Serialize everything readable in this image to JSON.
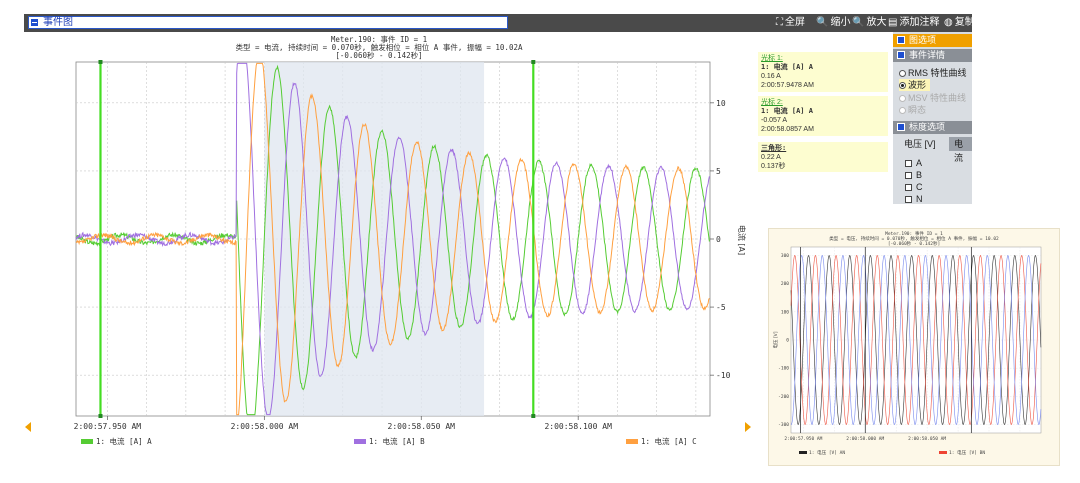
{
  "window": {
    "title": "事件图"
  },
  "toolbar": {
    "fullscreen_label": "全屏",
    "zoom_out_label": "缩小",
    "zoom_in_label": "放大",
    "add_note_label": "添加注释",
    "copy_label": "复制"
  },
  "chart": {
    "title_line1": "Meter.190: 事件 ID = 1",
    "title_line2": "类型 = 电流, 持续时间 = 0.070秒, 触发相位 = 相位 A 事件, 振幅 = 10.02A",
    "title_line3": "[-0.060秒 - 0.142秒]",
    "y_axis_title": "电流 [A]",
    "x_ticks": [
      "2:00:57.950 AM",
      "2:00:58.000 AM",
      "2:00:58.050 AM",
      "2:00:58.100 AM"
    ],
    "y_ticks": [
      "10",
      "5",
      "0",
      "-5",
      "-10"
    ],
    "legend": [
      {
        "label": "1: 电流 [A] A",
        "color": "#55cc33"
      },
      {
        "label": "1: 电流 [A] B",
        "color": "#a070e0"
      },
      {
        "label": "1: 电流 [A] C",
        "color": "#ffa040"
      }
    ]
  },
  "cursors": {
    "c1": {
      "header": "光标 1:",
      "channel": "1: 电流 [A] A",
      "value": "0.16 A",
      "time": "2:00:57.9478 AM"
    },
    "c2": {
      "header": "光标 2:",
      "channel": "1: 电流 [A] A",
      "value": "-0.057 A",
      "time": "2:00:58.0857 AM"
    },
    "delta": {
      "header": "三角形:",
      "value": "0.22 A",
      "time": "0.137秒"
    }
  },
  "options": {
    "header_chart": "图选项",
    "header_event": "事件详情",
    "radio_rms": "RMS 特性曲线",
    "radio_wave": "波形",
    "radio_msv": "MSV 特性曲线",
    "radio_transient": "瞬态",
    "header_scale": "标度选项",
    "tab_voltage": "电压 [V]",
    "tab_current": "电流",
    "check_a": "A",
    "check_b": "B",
    "check_c": "C",
    "check_n": "N"
  },
  "thumbnail": {
    "title_line1": "Meter.190: 事件 ID = 1",
    "title_line2": "类型 = 电压, 持续时间 = 0.070秒, 触发相位 = 相位 A 事件, 振幅 = 10.02",
    "title_line3": "[-0.060秒 - 0.142秒]",
    "y_axis_title": "电压 [V]",
    "x_ticks": [
      "2:00:57.950 AM",
      "2:00:58.000 AM",
      "2:00:58.050 AM"
    ],
    "y_ticks": [
      "300",
      "200",
      "100",
      "0",
      "-100",
      "-200",
      "-300"
    ],
    "legend": [
      "1: 电压 [V] AN",
      "1: 电压 [V] BN"
    ]
  },
  "chart_data": {
    "type": "line",
    "x_unit": "s",
    "xlim": [
      -0.06,
      0.142
    ],
    "ylim": [
      -13,
      13
    ],
    "grid": true,
    "series": [
      {
        "name": "1: 电流 [A] A",
        "color": "#55cc33"
      },
      {
        "name": "1: 电流 [A] B",
        "color": "#a070e0"
      },
      {
        "name": "1: 电流 [A] C",
        "color": "#ffa040"
      }
    ],
    "cursors": [
      -0.0522,
      0.0857
    ],
    "highlight_range": [
      0.0,
      0.07
    ],
    "fault_start": -0.009,
    "frequency_hz": 60,
    "pre_fault_amplitude": 0.3,
    "clip_level": 12.9,
    "fault_peak": 16,
    "decay_to": 5
  }
}
